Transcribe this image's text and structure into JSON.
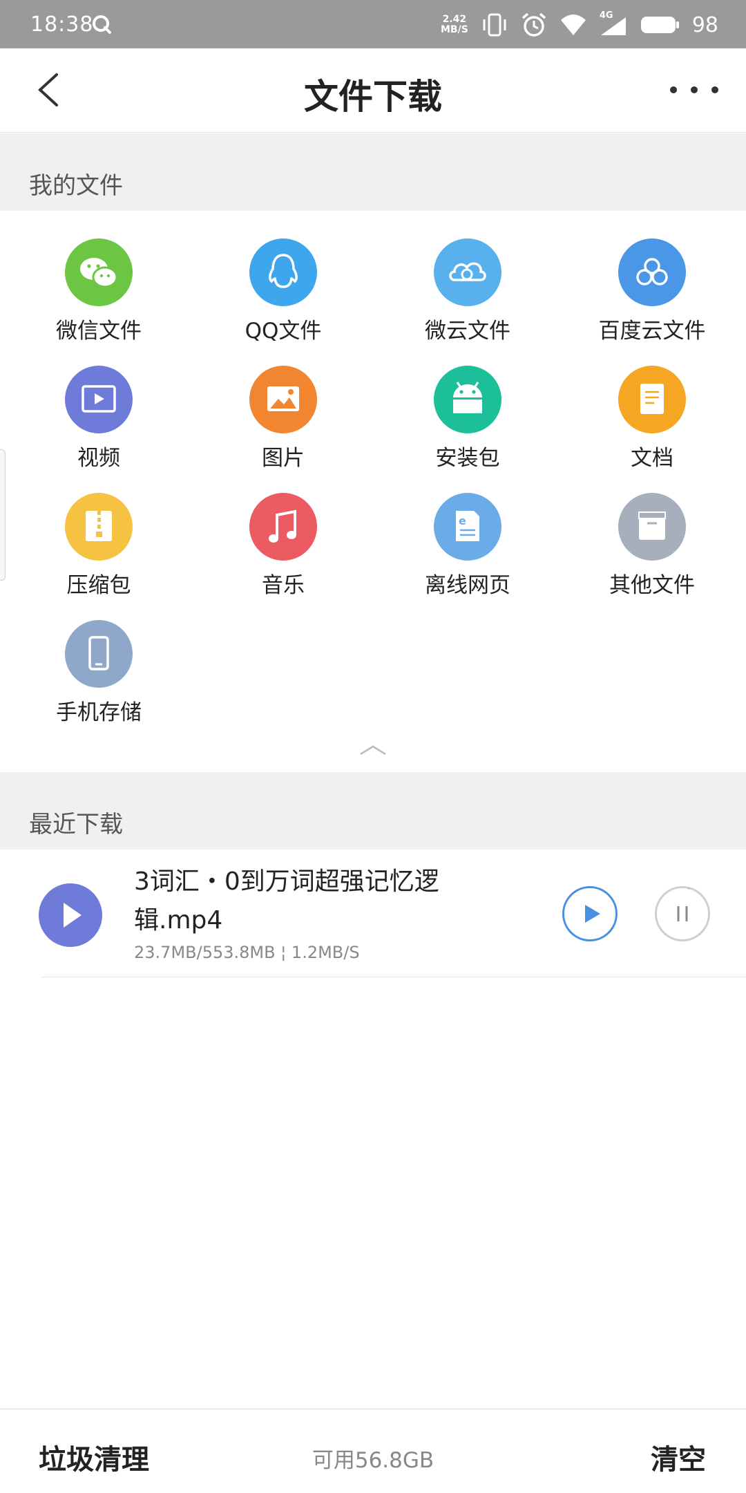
{
  "status_bar": {
    "time": "18:38",
    "net_speed_value": "2.42",
    "net_speed_unit": "MB/S",
    "network_type": "4G",
    "battery": "98"
  },
  "header": {
    "title": "文件下载"
  },
  "my_files": {
    "section_label": "我的文件",
    "items": [
      {
        "label": "微信文件",
        "icon": "wechat-icon",
        "color": "#6cc644"
      },
      {
        "label": "QQ文件",
        "icon": "qq-penguin-icon",
        "color": "#3ea6ec"
      },
      {
        "label": "微云文件",
        "icon": "weiyun-cloud-icon",
        "color": "#58b0ec"
      },
      {
        "label": "百度云文件",
        "icon": "baidu-cloud-icon",
        "color": "#4a97e8"
      },
      {
        "label": "视频",
        "icon": "video-icon",
        "color": "#6f7bd9"
      },
      {
        "label": "图片",
        "icon": "image-icon",
        "color": "#f2852f"
      },
      {
        "label": "安装包",
        "icon": "android-icon",
        "color": "#1dbf9a"
      },
      {
        "label": "文档",
        "icon": "document-icon",
        "color": "#f5a623"
      },
      {
        "label": "压缩包",
        "icon": "zip-icon",
        "color": "#f5c242"
      },
      {
        "label": "音乐",
        "icon": "music-note-icon",
        "color": "#ec5a62"
      },
      {
        "label": "离线网页",
        "icon": "offline-webpage-icon",
        "color": "#6aabe8"
      },
      {
        "label": "其他文件",
        "icon": "other-file-icon",
        "color": "#a7afbd"
      },
      {
        "label": "手机存储",
        "icon": "phone-storage-icon",
        "color": "#8fa8c9"
      }
    ]
  },
  "recent_downloads": {
    "section_label": "最近下载",
    "items": [
      {
        "title": "3词汇・0到万词超强记忆逻辑.mp4",
        "meta": "23.7MB/553.8MB ¦ 1.2MB/S",
        "progress_fraction": 0.043
      }
    ]
  },
  "bottom_bar": {
    "clean_label": "垃圾清理",
    "storage_label": "可用56.8GB",
    "clear_label": "清空"
  }
}
